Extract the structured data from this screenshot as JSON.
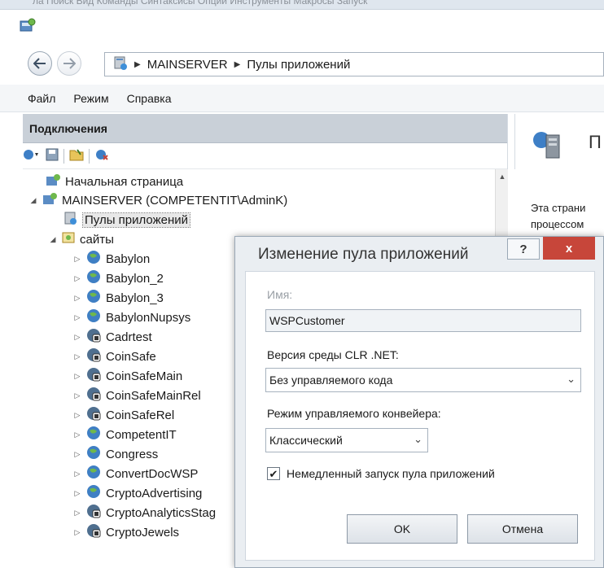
{
  "top_strip_text": "ла   Поиск   Вид   Команды   Синтаксисы   Опции   Инструменты   Макросы   Запуск",
  "address_bar": {
    "crumbs": [
      "MAINSERVER",
      "Пулы приложений"
    ]
  },
  "menu": [
    "Файл",
    "Режим",
    "Справка"
  ],
  "connections": {
    "header": "Подключения",
    "tree": [
      {
        "label": "Начальная страница",
        "level": 0,
        "icon": "start-page-icon"
      },
      {
        "label": "MAINSERVER (COMPETENTIT\\AdminK)",
        "level": 0,
        "icon": "server-icon"
      },
      {
        "label": "Пулы приложений",
        "level": 1,
        "icon": "app-pools-icon",
        "selected": true
      },
      {
        "label": "сайты",
        "level": 1,
        "icon": "sites-folder-icon"
      },
      {
        "label": "Babylon",
        "level": 2,
        "icon": "globe-icon"
      },
      {
        "label": "Babylon_2",
        "level": 2,
        "icon": "globe-icon"
      },
      {
        "label": "Babylon_3",
        "level": 2,
        "icon": "globe-icon"
      },
      {
        "label": "BabylonNupsys",
        "level": 2,
        "icon": "globe-icon"
      },
      {
        "label": "Cadrtest",
        "level": 2,
        "icon": "stopped-site-icon"
      },
      {
        "label": "CoinSafe",
        "level": 2,
        "icon": "stopped-site-icon"
      },
      {
        "label": "CoinSafeMain",
        "level": 2,
        "icon": "stopped-site-icon"
      },
      {
        "label": "CoinSafeMainRel",
        "level": 2,
        "icon": "stopped-site-icon"
      },
      {
        "label": "CoinSafeRel",
        "level": 2,
        "icon": "stopped-site-icon"
      },
      {
        "label": "CompetentIT",
        "level": 2,
        "icon": "globe-icon"
      },
      {
        "label": "Congress",
        "level": 2,
        "icon": "globe-icon"
      },
      {
        "label": "ConvertDocWSP",
        "level": 2,
        "icon": "globe-icon"
      },
      {
        "label": "CryptoAdvertising",
        "level": 2,
        "icon": "globe-icon"
      },
      {
        "label": "CryptoAnalyticsStag",
        "level": 2,
        "icon": "stopped-site-icon"
      },
      {
        "label": "CryptoJewels",
        "level": 2,
        "icon": "stopped-site-icon"
      }
    ]
  },
  "right_panel": {
    "title": "П",
    "text_line1": "Эта страни",
    "text_line2": "процессом"
  },
  "dialog": {
    "title": "Изменение пула приложений",
    "help": "?",
    "close": "x",
    "name_label": "Имя:",
    "name_value": "WSPCustomer",
    "clr_label": "Версия среды CLR .NET:",
    "clr_value": "Без управляемого кода",
    "pipeline_label": "Режим управляемого конвейера:",
    "pipeline_value": "Классический",
    "autostart_label": "Немедленный запуск пула приложений",
    "autostart_checked": true,
    "ok_label": "OK",
    "cancel_label": "Отмена"
  }
}
